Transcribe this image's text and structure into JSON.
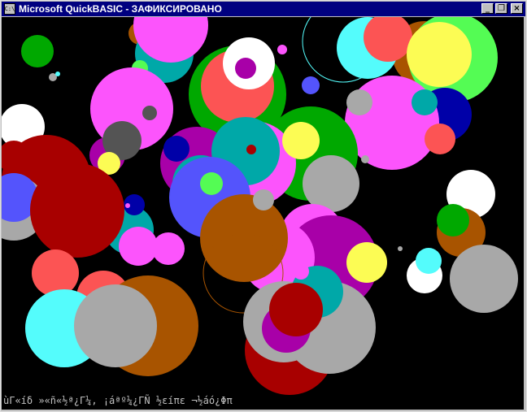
{
  "window": {
    "title": "Microsoft QuickBASIC - ЗАФИКСИРОВАНО",
    "icon_text": "C:\\",
    "controls": {
      "minimize": "_",
      "maximize": "❐",
      "close": "×"
    }
  },
  "screen": {
    "status_line": "ùΓ«íδ »«ñ«½ª¿Γ¼, ¡áªº¼¿ΓÑ ½εíπε ¬½áó¿Φπ"
  },
  "colors": {
    "titlebar": "#000080",
    "background": "#000000"
  }
}
